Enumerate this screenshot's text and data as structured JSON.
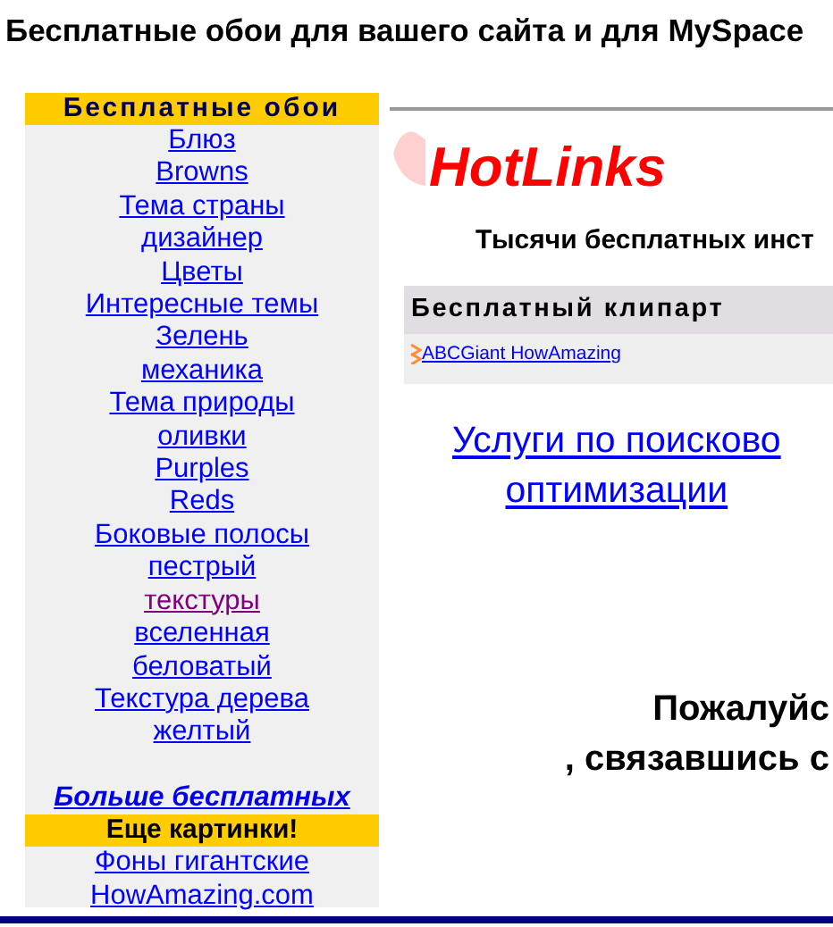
{
  "page_title": "Бесплатные обои для вашего сайта и для MySpace",
  "sidebar": {
    "heading": "Бесплатные обои",
    "links": [
      {
        "label": "Блюз",
        "visited": false
      },
      {
        "label": "Browns",
        "visited": false
      },
      {
        "label": "Тема страны",
        "visited": false
      },
      {
        "label": "дизайнер",
        "visited": false
      },
      {
        "label": "Цветы",
        "visited": false
      },
      {
        "label": "Интересные темы",
        "visited": false
      },
      {
        "label": "Зелень",
        "visited": false
      },
      {
        "label": "механика",
        "visited": false
      },
      {
        "label": "Тема природы",
        "visited": false
      },
      {
        "label": "оливки",
        "visited": false
      },
      {
        "label": "Purples",
        "visited": false
      },
      {
        "label": "Reds",
        "visited": false
      },
      {
        "label": "Боковые полосы",
        "visited": false
      },
      {
        "label": "пестрый",
        "visited": false
      },
      {
        "label": "текстуры",
        "visited": true
      },
      {
        "label": "вселенная",
        "visited": false
      },
      {
        "label": "беловатый",
        "visited": false
      },
      {
        "label": "Текстура дерева",
        "visited": false
      },
      {
        "label": "желтый",
        "visited": false
      }
    ],
    "more_link": "Больше бесплатных",
    "more_heading": "Еще картинки!",
    "more_links": [
      {
        "label": "Фоны гигантские",
        "visited": false
      },
      {
        "label": "HowAmazing.com",
        "visited": false
      }
    ]
  },
  "main": {
    "logo": "HotLinks",
    "tagline": "Тысячи бесплатных инст",
    "clipart": {
      "heading": "Бесплатный клипарт",
      "link": "ABCGiant HowAmazing"
    },
    "seo_link": [
      "Услуги по поисково",
      "оптимизации"
    ],
    "contact": [
      "Пожалуйс",
      ", связавшись с"
    ]
  }
}
